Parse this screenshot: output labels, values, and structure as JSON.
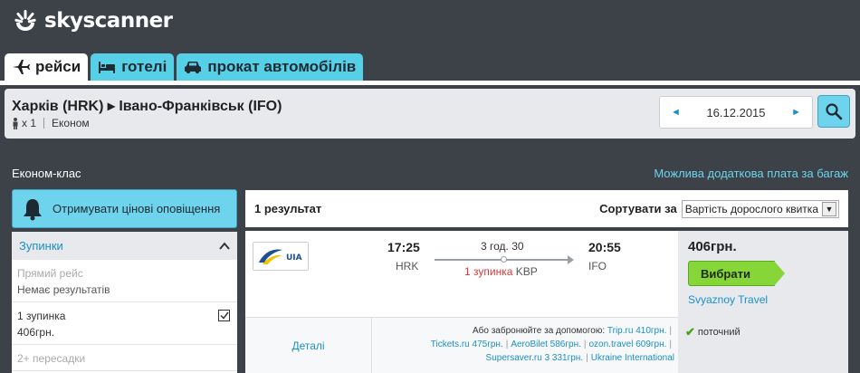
{
  "brand": {
    "name": "skyscanner"
  },
  "tabs": [
    {
      "label": "рейси",
      "icon": "plane-icon",
      "active": true
    },
    {
      "label": "готелі",
      "icon": "bed-icon",
      "active": false
    },
    {
      "label": "прокат автомобілів",
      "icon": "car-icon",
      "active": false
    }
  ],
  "search": {
    "route": "Харків (HRK) ▸ Івано-Франківськ (IFO)",
    "passengers": "x 1",
    "cabin": "Економ",
    "date": "16.12.2015",
    "prev_arrow": "◄",
    "next_arrow": "►"
  },
  "panel": {
    "cabin_class": "Економ-клас",
    "baggage_note": "Можлива додаткова плата за багаж"
  },
  "alerts": {
    "label": "Отримувати цінові оповіщення"
  },
  "filters": {
    "title": "Зупинки",
    "options": [
      {
        "name": "Прямий рейс",
        "sub": "Немає результатів",
        "enabled": false
      },
      {
        "name": "1 зупинка",
        "sub": "406грн.",
        "enabled": true,
        "checked": true
      },
      {
        "name": "2+ пересадки",
        "sub": "",
        "enabled": false
      }
    ]
  },
  "results": {
    "count": "1 результат",
    "sort_label": "Сортувати за",
    "sort_value": "Вартість дорослого квитка",
    "sort_dd": "▼"
  },
  "flight": {
    "airline": "UIA",
    "dep_time": "17:25",
    "dep_code": "HRK",
    "arr_time": "20:55",
    "arr_code": "IFO",
    "duration": "3 год. 30",
    "stops": "1 зупинка",
    "via": "KBP",
    "details": "Деталі",
    "book_with": "Або забронюйте за допомогою:",
    "agents": [
      "Trip.ru 410грн.",
      "Tickets.ru 475грн.",
      "AeroBilet 586грн.",
      "ozon.travel 609грн.",
      "Supersaver.ru 3 331грн.",
      "Ukraine International"
    ],
    "price": "406грн.",
    "select_label": "Вибрати",
    "agent": "Svyaznoy Travel",
    "current": "поточний"
  },
  "colors": {
    "accent": "#6ed3ec",
    "link": "#1b8fc7",
    "select_green": "#86d63a",
    "dark_bg": "#3d4249",
    "stops_red": "#d9383a"
  }
}
